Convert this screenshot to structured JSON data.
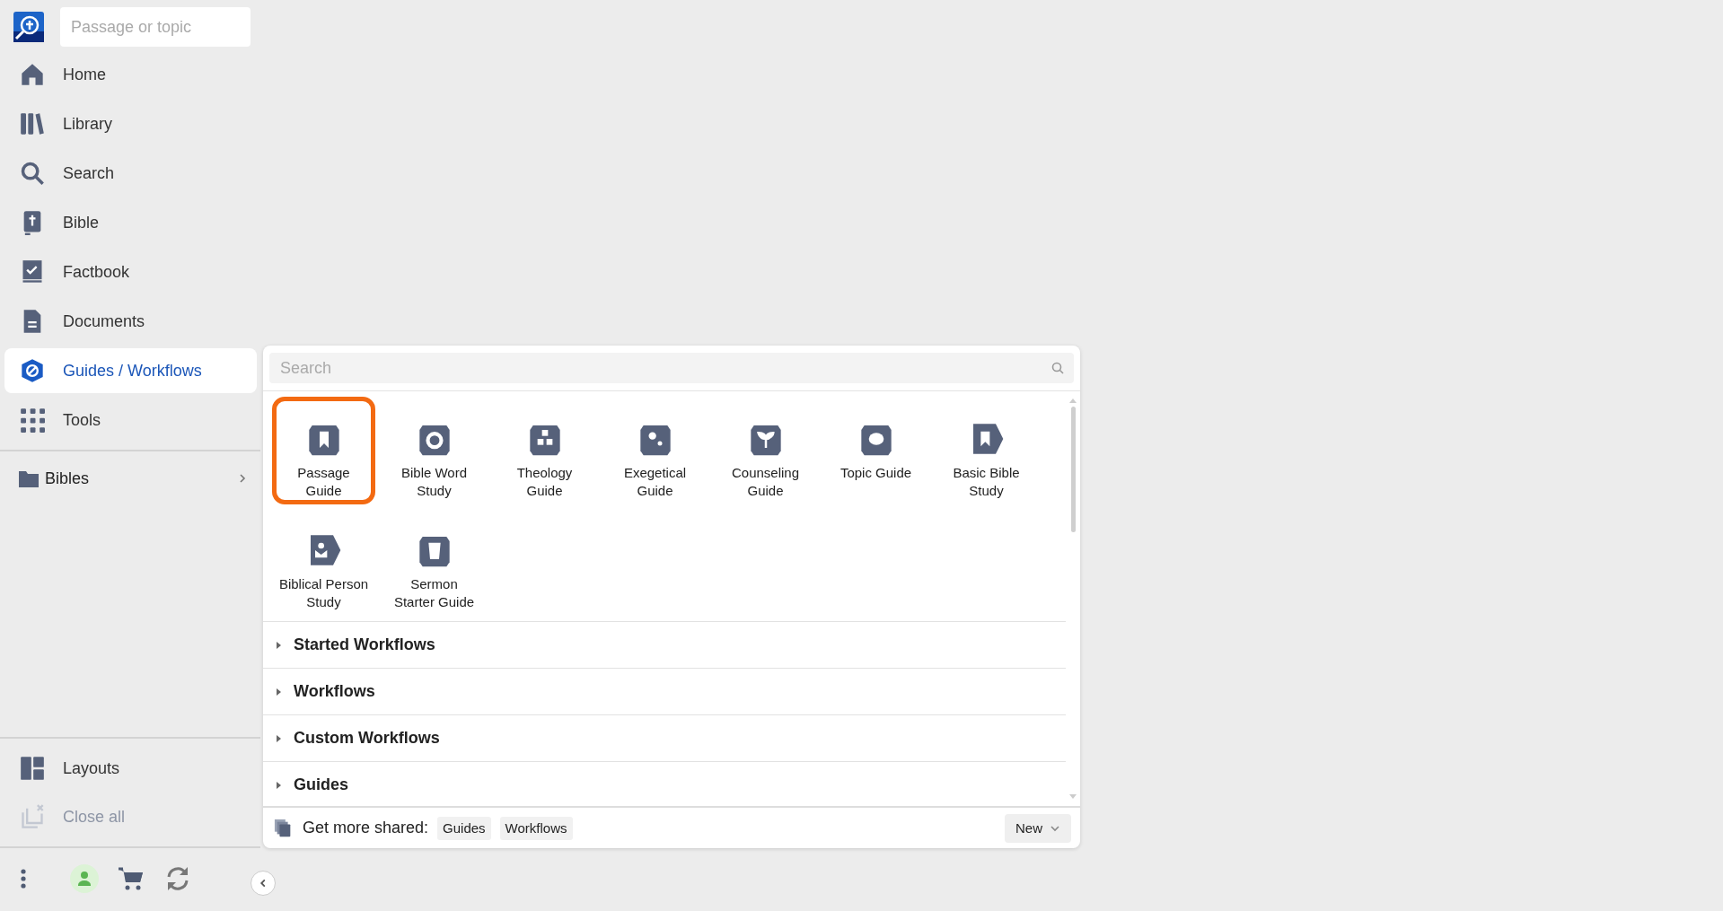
{
  "sidebar": {
    "search": {
      "placeholder": "Passage or topic"
    },
    "items": [
      {
        "label": "Home",
        "selected": false
      },
      {
        "label": "Library",
        "selected": false
      },
      {
        "label": "Search",
        "selected": false
      },
      {
        "label": "Bible",
        "selected": false
      },
      {
        "label": "Factbook",
        "selected": false
      },
      {
        "label": "Documents",
        "selected": false
      },
      {
        "label": "Guides / Workflows",
        "selected": true
      },
      {
        "label": "Tools",
        "selected": false
      }
    ],
    "folder": {
      "label": "Bibles",
      "expanded": false
    },
    "bottom_items": [
      {
        "label": "Layouts",
        "disabled": false
      },
      {
        "label": "Close all",
        "disabled": true
      }
    ]
  },
  "panel": {
    "search": {
      "placeholder": "Search"
    },
    "tiles": [
      {
        "label": "Passage Guide",
        "selected": true
      },
      {
        "label": "Bible Word Study",
        "selected": false
      },
      {
        "label": "Theology Guide",
        "selected": false
      },
      {
        "label": "Exegetical Guide",
        "selected": false
      },
      {
        "label": "Counseling Guide",
        "selected": false
      },
      {
        "label": "Topic Guide",
        "selected": false
      },
      {
        "label": "Basic Bible Study",
        "selected": false
      },
      {
        "label": "Biblical Person Study",
        "selected": false
      },
      {
        "label": "Sermon Starter Guide",
        "selected": false
      }
    ],
    "sections": [
      {
        "label": "Started Workflows",
        "expanded": false
      },
      {
        "label": "Workflows",
        "expanded": false
      },
      {
        "label": "Custom Workflows",
        "expanded": false
      },
      {
        "label": "Guides",
        "expanded": false
      }
    ],
    "footer": {
      "label": "Get more shared:",
      "links": [
        "Guides",
        "Workflows"
      ],
      "new_button": "New"
    }
  }
}
